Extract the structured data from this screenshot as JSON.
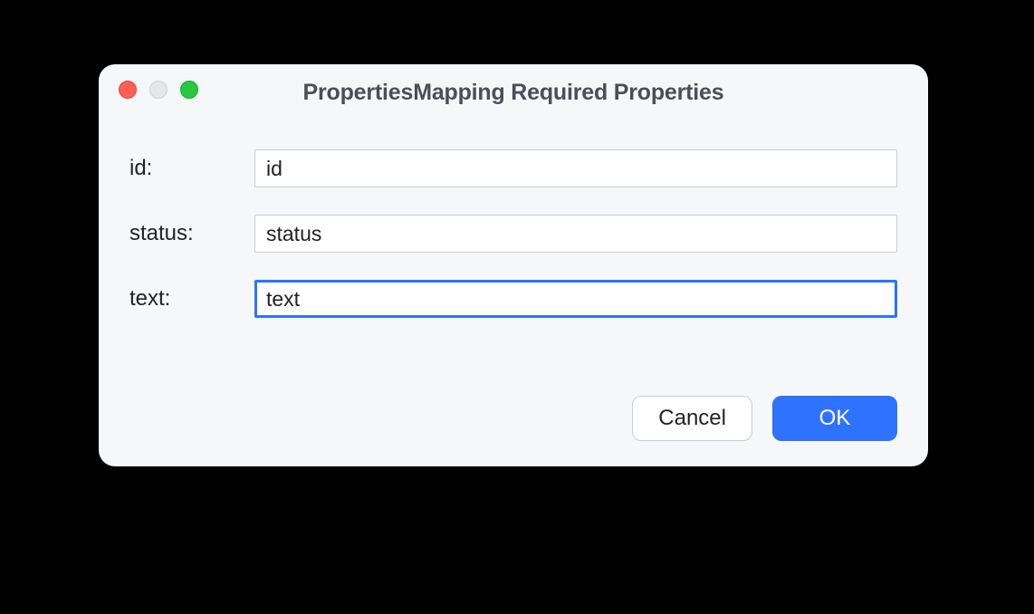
{
  "title": "PropertiesMapping Required Properties",
  "fields": {
    "id": {
      "label": "id:",
      "value": "id"
    },
    "status": {
      "label": "status:",
      "value": "status"
    },
    "text": {
      "label": "text:",
      "value": "text"
    }
  },
  "buttons": {
    "cancel": "Cancel",
    "ok": "OK"
  },
  "colors": {
    "accent": "#2f72ff"
  }
}
